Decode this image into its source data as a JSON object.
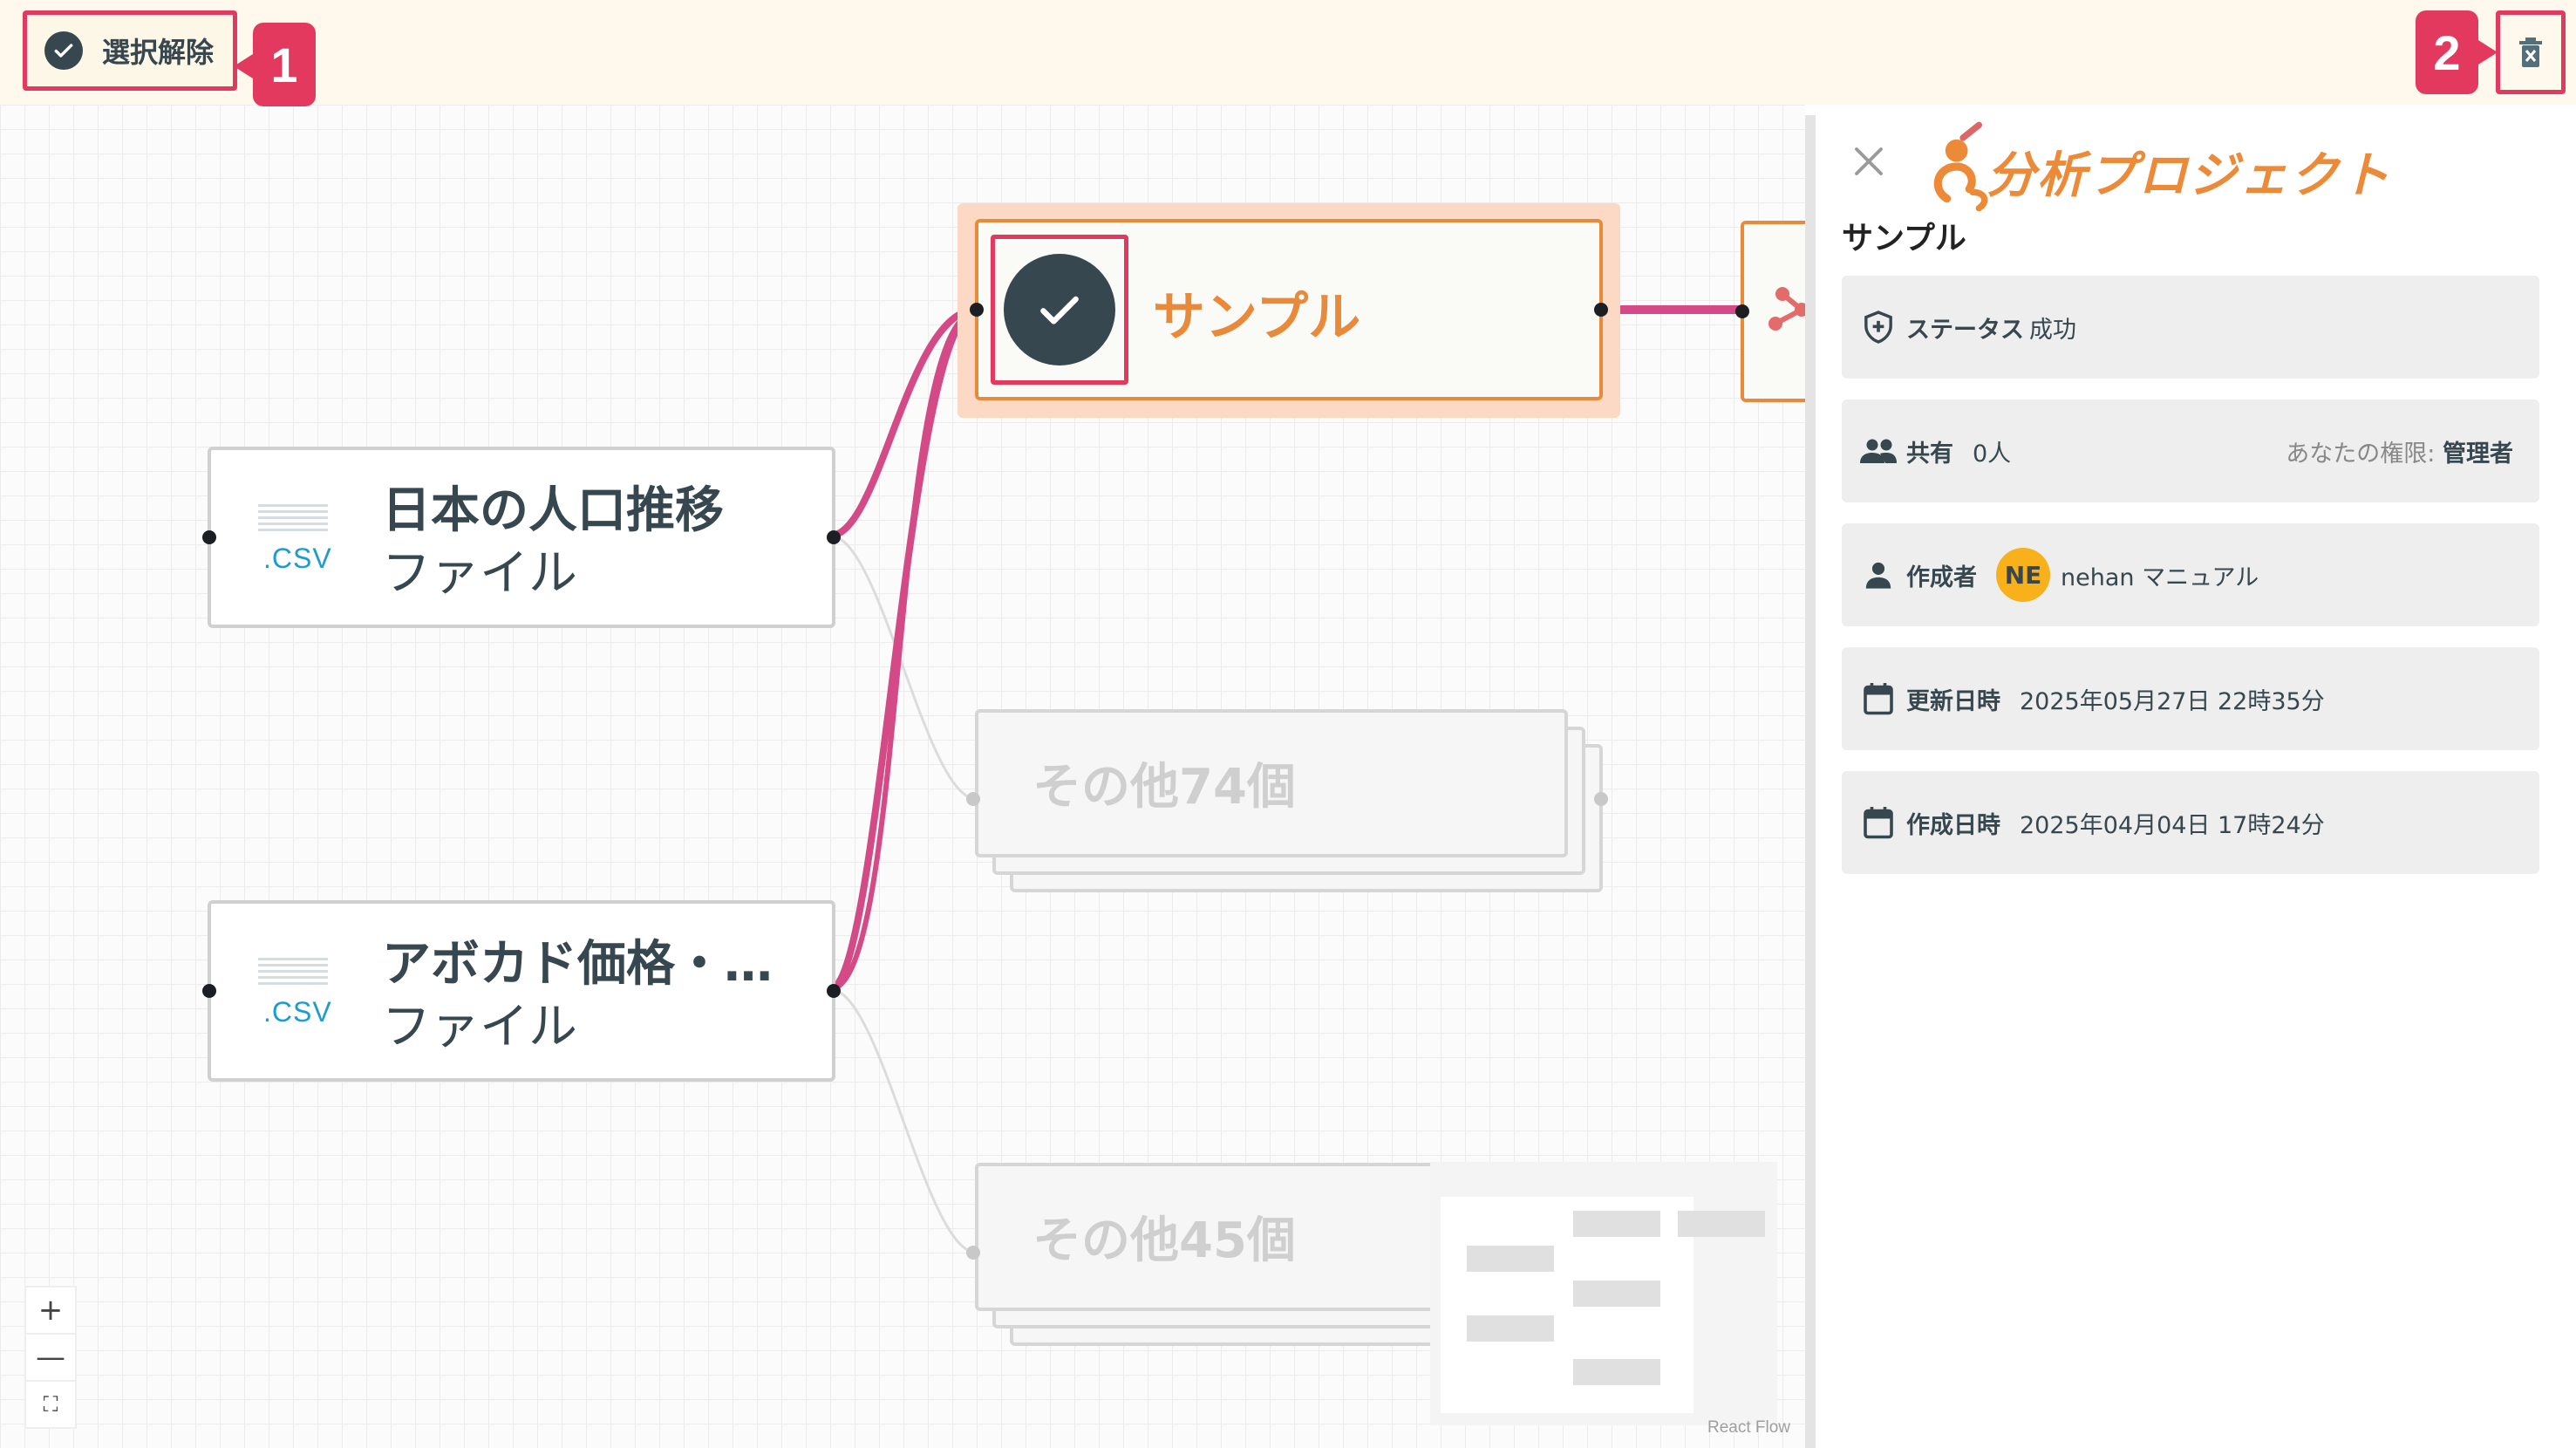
{
  "toolbar": {
    "deselect_label": "選択解除",
    "callout_1": "1",
    "callout_2": "2"
  },
  "flow": {
    "nodes": [
      {
        "title": "日本の人口推移",
        "subtitle": "ファイル",
        "icon_text": ".CSV"
      },
      {
        "title": "アボカド価格・…",
        "subtitle": "ファイル",
        "icon_text": ".CSV"
      }
    ],
    "selected_node": {
      "title": "サンプル"
    },
    "groups": [
      {
        "label": "その他74個"
      },
      {
        "label": "その他45個"
      }
    ],
    "zoom_in": "+",
    "zoom_out": "—",
    "fit_view": "⛶",
    "attribution": "React Flow",
    "edge_color": "#d44a86",
    "accent_color": "#e98a3a"
  },
  "panel": {
    "project_title": "分析プロジェクト",
    "name": "サンプル",
    "status": {
      "label": "ステータス",
      "value": "成功"
    },
    "share": {
      "label": "共有",
      "value": "0人",
      "permission_label": "あなたの権限:",
      "permission_value": "管理者"
    },
    "creator": {
      "label": "作成者",
      "initials": "NE",
      "name": "nehan マニュアル"
    },
    "updated": {
      "label": "更新日時",
      "value": "2025年05月27日 22時35分"
    },
    "created": {
      "label": "作成日時",
      "value": "2025年04月04日 17時24分"
    }
  }
}
